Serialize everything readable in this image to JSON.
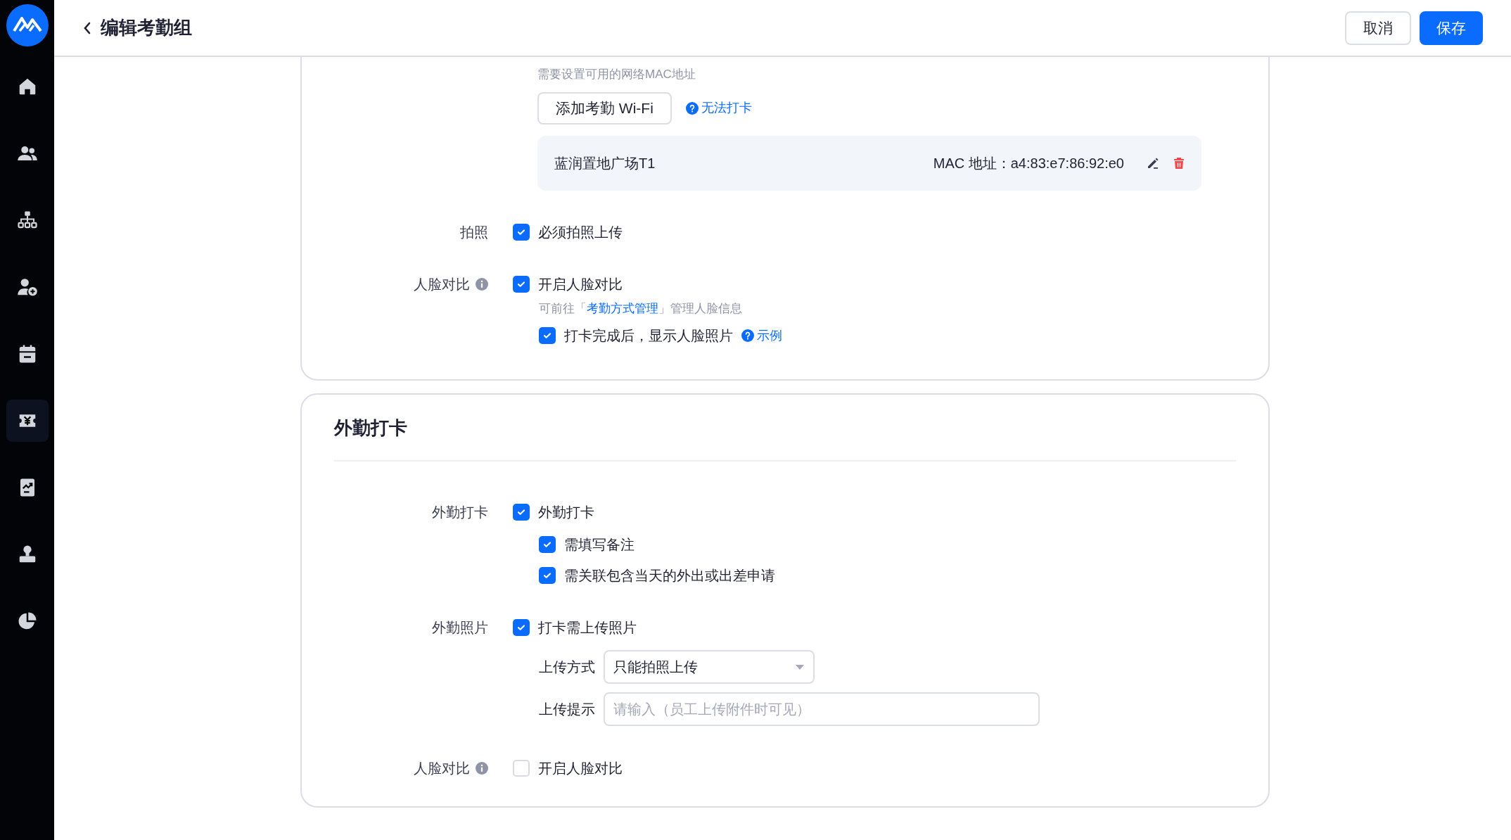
{
  "sidebar": {
    "items": [
      {
        "kind": "home",
        "selected": false
      },
      {
        "kind": "users",
        "selected": false
      },
      {
        "kind": "org",
        "selected": false
      },
      {
        "kind": "user-add",
        "selected": false
      },
      {
        "kind": "calendar",
        "selected": false
      },
      {
        "kind": "yen",
        "selected": true
      },
      {
        "kind": "report",
        "selected": false
      },
      {
        "kind": "stamp",
        "selected": false
      },
      {
        "kind": "pie",
        "selected": false
      }
    ]
  },
  "header": {
    "title": "编辑考勤组",
    "buttons": [
      {
        "label": "取消",
        "kind": "secondary"
      },
      {
        "label": "保存",
        "kind": "primary"
      }
    ]
  },
  "wifi": {
    "hint": "需要设置可用的网络MAC地址",
    "add_button": "添加考勤 Wi-Fi",
    "help_link": "无法打卡",
    "entries": [
      {
        "name": "蓝润置地广场T1",
        "mac": "MAC 地址：a4:83:e7:86:92:e0"
      }
    ]
  },
  "top_rows": [
    {
      "label": "拍照",
      "info": false,
      "items": [
        {
          "kind": "checkbox",
          "label": "必须拍照上传",
          "checked": true
        }
      ]
    },
    {
      "label": "人脸对比",
      "info": true,
      "items": [
        {
          "kind": "checkbox",
          "label": "开启人脸对比",
          "checked": true,
          "children": [
            {
              "kind": "hint",
              "before": "可前往「",
              "link": "考勤方式管理",
              "after": "」管理人脸信息"
            },
            {
              "kind": "checkbox",
              "label": "打卡完成后，显示人脸照片",
              "checked": true,
              "help_link": "示例"
            }
          ]
        }
      ]
    }
  ],
  "outside": {
    "title": "外勤打卡",
    "rows": [
      {
        "label": "外勤打卡",
        "info": false,
        "items": [
          {
            "kind": "checkbox",
            "label": "外勤打卡",
            "checked": true,
            "children": [
              {
                "kind": "checkbox",
                "label": "需填写备注",
                "checked": true
              },
              {
                "kind": "checkbox",
                "label": "需关联包含当天的外出或出差申请",
                "checked": true
              }
            ]
          }
        ]
      },
      {
        "label": "外勤照片",
        "info": false,
        "items": [
          {
            "kind": "checkbox",
            "label": "打卡需上传照片",
            "checked": true,
            "children": [
              {
                "kind": "select",
                "label": "上传方式",
                "value": "只能拍照上传"
              },
              {
                "kind": "input",
                "label": "上传提示",
                "placeholder": "请输入（员工上传附件时可见）"
              }
            ]
          }
        ]
      },
      {
        "label": "人脸对比",
        "info": true,
        "items": [
          {
            "kind": "checkbox",
            "label": "开启人脸对比",
            "checked": false
          }
        ]
      }
    ]
  }
}
